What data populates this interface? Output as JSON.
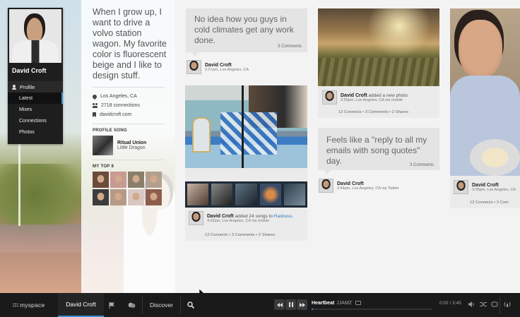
{
  "profile": {
    "name": "David Croft",
    "quote": "When I grow up, I want to drive a volvo station wagon. My favorite color is fluorescent beige and I like to design stuff.",
    "location": "Los Angeles, CA",
    "connections": "2718 connections",
    "website": "davidcroft.com",
    "profile_song_label": "PROFILE SONG",
    "song_title": "Ritual Union",
    "song_artist": "Little Dragon",
    "top8_label": "MY TOP 8",
    "top8_colors": [
      "#6b4b3c",
      "#c79a92",
      "#8a7f6c",
      "#b2a08f",
      "#3d3d3d",
      "#b69a88",
      "#d8c8c3",
      "#8d5e4d"
    ]
  },
  "menu": {
    "header": "Profile",
    "items": [
      "Latest",
      "Mixes",
      "Connections",
      "Photos"
    ]
  },
  "feed": {
    "quote1": {
      "text": "No idea how you guys in cold climates get any work done.",
      "comments": "3 Comments",
      "author": "David Croft",
      "meta": "2:57pm, Los Angeles, CA"
    },
    "songs_post": {
      "author": "David Croft",
      "action": "added 24 songs to",
      "link": "Radness.",
      "meta": "4:02pm, Los Angeles, CA via mobile",
      "stats": "12 Connects  •  3 Comments  •  2 Shares"
    },
    "photo_post": {
      "author": "David Croft",
      "action": "added a new photo.",
      "meta": "3:55pm, Los Angeles, CA via mobile",
      "stats": "12 Connects  •  3 Comments  •  2 Shares"
    },
    "quote2": {
      "text": "Feels like a \"reply to all my emails with song quotes\" day.",
      "comments": "3 Comments",
      "author": "David Croft",
      "meta": "3:44pm, Los Angeles, CA via Twitter"
    },
    "photo_post2": {
      "author": "David Croft",
      "meta": "3:05pm, Los Angeles, CA",
      "stats": "12 Connects  •  3 Com"
    }
  },
  "bottom_bar": {
    "logo": "myspace",
    "user": "David Croft",
    "discover": "Discover",
    "track": "Heartbeat",
    "artist": "JJAMZ",
    "time": "0:02 / 3:45",
    "progress": 0.01
  },
  "colors": {
    "accent": "#3a8fd0",
    "bar": "#1a1a1a"
  }
}
